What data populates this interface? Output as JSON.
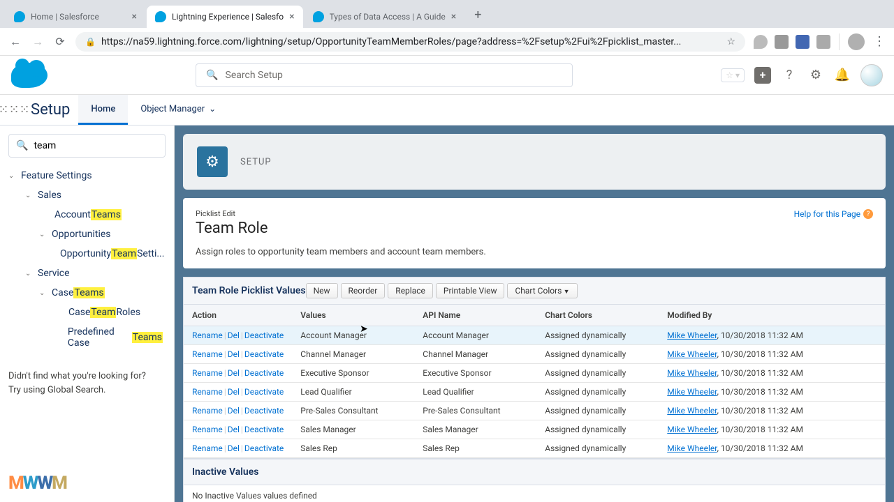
{
  "browser": {
    "tabs": [
      {
        "title": "Home | Salesforce",
        "active": false
      },
      {
        "title": "Lightning Experience | Salesfo",
        "active": true
      },
      {
        "title": "Types of Data Access | A Guide",
        "active": false
      }
    ],
    "url": "https://na59.lightning.force.com/lightning/setup/OpportunityTeamMemberRoles/page?address=%2Fsetup%2Fui%2Fpicklist_master..."
  },
  "header": {
    "search_placeholder": "Search Setup"
  },
  "nav": {
    "app": "Setup",
    "tabs": [
      "Home",
      "Object Manager"
    ]
  },
  "sidebar": {
    "search_value": "team",
    "tree": {
      "feature_settings": "Feature Settings",
      "sales": "Sales",
      "account_teams_pre": "Account ",
      "account_teams_hl": "Teams",
      "opportunities": "Opportunities",
      "opp_team_pre": "Opportunity ",
      "opp_team_hl": "Team",
      "opp_team_post": " Setti...",
      "service": "Service",
      "case_teams_pre": "Case ",
      "case_teams_hl": "Teams",
      "case_team_roles_pre": "Case ",
      "case_team_roles_hl": "Team",
      "case_team_roles_post": " Roles",
      "predef_pre": "Predefined Case ",
      "predef_hl": "Teams"
    },
    "footer_l1": "Didn't find what you're looking for?",
    "footer_l2": "Try using Global Search."
  },
  "banner": {
    "label": "SETUP"
  },
  "page": {
    "sub": "Picklist Edit",
    "title": "Team Role",
    "help": "Help for this Page",
    "desc": "Assign roles to opportunity team members and account team members."
  },
  "table": {
    "title": "Team Role Picklist Values",
    "buttons": [
      "New",
      "Reorder",
      "Replace",
      "Printable View",
      "Chart Colors"
    ],
    "columns": [
      "Action",
      "Values",
      "API Name",
      "Chart Colors",
      "Modified By"
    ],
    "action_rename": "Rename",
    "action_del": "Del",
    "action_deact": "Deactivate",
    "rows": [
      {
        "value": "Account Manager",
        "api": "Account Manager",
        "color": "Assigned dynamically",
        "user": "Mike Wheeler",
        "date": "10/30/2018 11:32 AM"
      },
      {
        "value": "Channel Manager",
        "api": "Channel Manager",
        "color": "Assigned dynamically",
        "user": "Mike Wheeler",
        "date": "10/30/2018 11:32 AM"
      },
      {
        "value": "Executive Sponsor",
        "api": "Executive Sponsor",
        "color": "Assigned dynamically",
        "user": "Mike Wheeler",
        "date": "10/30/2018 11:32 AM"
      },
      {
        "value": "Lead Qualifier",
        "api": "Lead Qualifier",
        "color": "Assigned dynamically",
        "user": "Mike Wheeler",
        "date": "10/30/2018 11:32 AM"
      },
      {
        "value": "Pre-Sales Consultant",
        "api": "Pre-Sales Consultant",
        "color": "Assigned dynamically",
        "user": "Mike Wheeler",
        "date": "10/30/2018 11:32 AM"
      },
      {
        "value": "Sales Manager",
        "api": "Sales Manager",
        "color": "Assigned dynamically",
        "user": "Mike Wheeler",
        "date": "10/30/2018 11:32 AM"
      },
      {
        "value": "Sales Rep",
        "api": "Sales Rep",
        "color": "Assigned dynamically",
        "user": "Mike Wheeler",
        "date": "10/30/2018 11:32 AM"
      }
    ]
  },
  "inactive": {
    "title": "Inactive Values",
    "body": "No Inactive Values values defined"
  }
}
